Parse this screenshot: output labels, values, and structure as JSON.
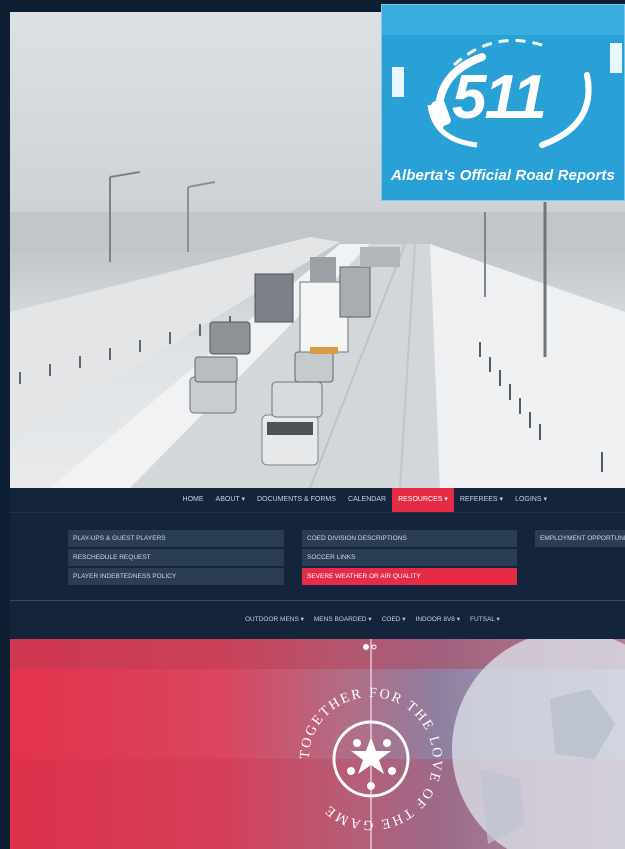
{
  "badge": {
    "number": "511",
    "tagline": "Alberta's Official Road Reports"
  },
  "nav": {
    "items": [
      {
        "label": "HOME"
      },
      {
        "label": "ABOUT ▾"
      },
      {
        "label": "DOCUMENTS & FORMS"
      },
      {
        "label": "CALENDAR"
      },
      {
        "label": "RESOURCES ▾",
        "active": true
      },
      {
        "label": "REFEREES ▾"
      },
      {
        "label": "LOGINS ▾"
      }
    ]
  },
  "dropdown": {
    "col1": [
      "PLAY-UPS & GUEST PLAYERS",
      "RESCHEDULE REQUEST",
      "PLAYER INDEBTEDNESS POLICY"
    ],
    "col2": [
      "COED DIVISION DESCRIPTIONS",
      "SOCCER LINKS",
      "SEVERE WEATHER OR AIR QUALITY"
    ],
    "col3": [
      "EMPLOYMENT OPPORTUNITIES"
    ]
  },
  "subnav": {
    "items": [
      "OUTDOOR MENS ▾",
      "MENS BOARDED ▾",
      "COED ▾",
      "INDOOR 8V8 ▾",
      "FUTSAL ▾"
    ]
  },
  "banner": {
    "emblem_text": "TOGETHER FOR THE LOVE OF THE GAME"
  },
  "colors": {
    "navy": "#14243a",
    "accent_red": "#e52b45",
    "badge_blue": "#2da3d8"
  }
}
